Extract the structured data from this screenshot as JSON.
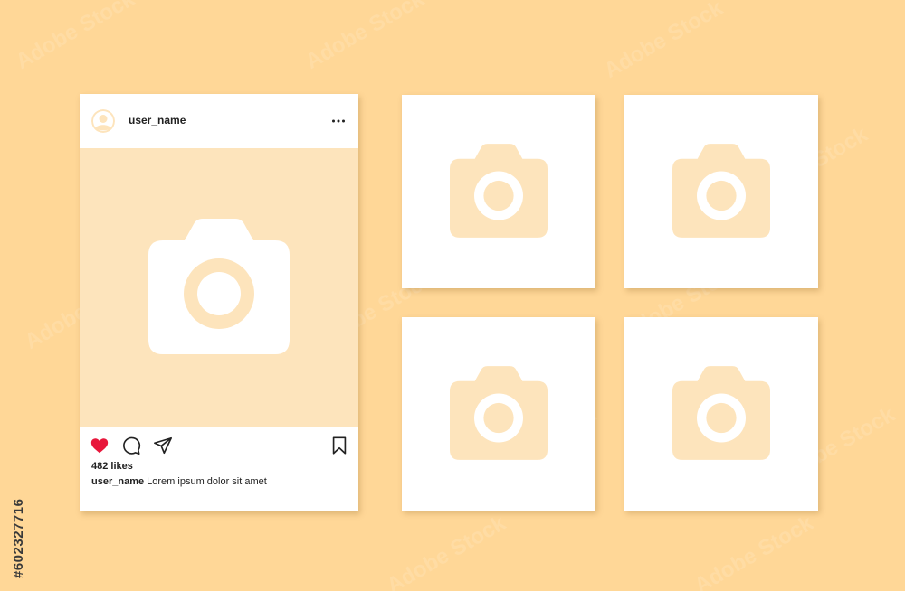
{
  "colors": {
    "background": "#FFD797",
    "post_image_bg": "#FDE4BC",
    "camera_on_peach": "#FFFFFF",
    "camera_on_white": "#FDE4BC",
    "like_heart": "#E8173B",
    "text": "#222222"
  },
  "post": {
    "username": "user_name",
    "likes": "482 likes",
    "caption_user": "user_name",
    "caption_text": " Lorem ipsum dolor sit amet",
    "icons": {
      "avatar": "user-avatar-icon",
      "more": "more-horizontal-icon",
      "image": "camera-icon",
      "like": "heart-icon",
      "comment": "comment-bubble-icon",
      "share": "send-icon",
      "save": "bookmark-icon"
    },
    "liked": true
  },
  "tiles": [
    {
      "icon": "camera-icon"
    },
    {
      "icon": "camera-icon"
    },
    {
      "icon": "camera-icon"
    },
    {
      "icon": "camera-icon"
    }
  ],
  "watermark": {
    "image_id": "#602327716",
    "text": "Adobe Stock"
  }
}
